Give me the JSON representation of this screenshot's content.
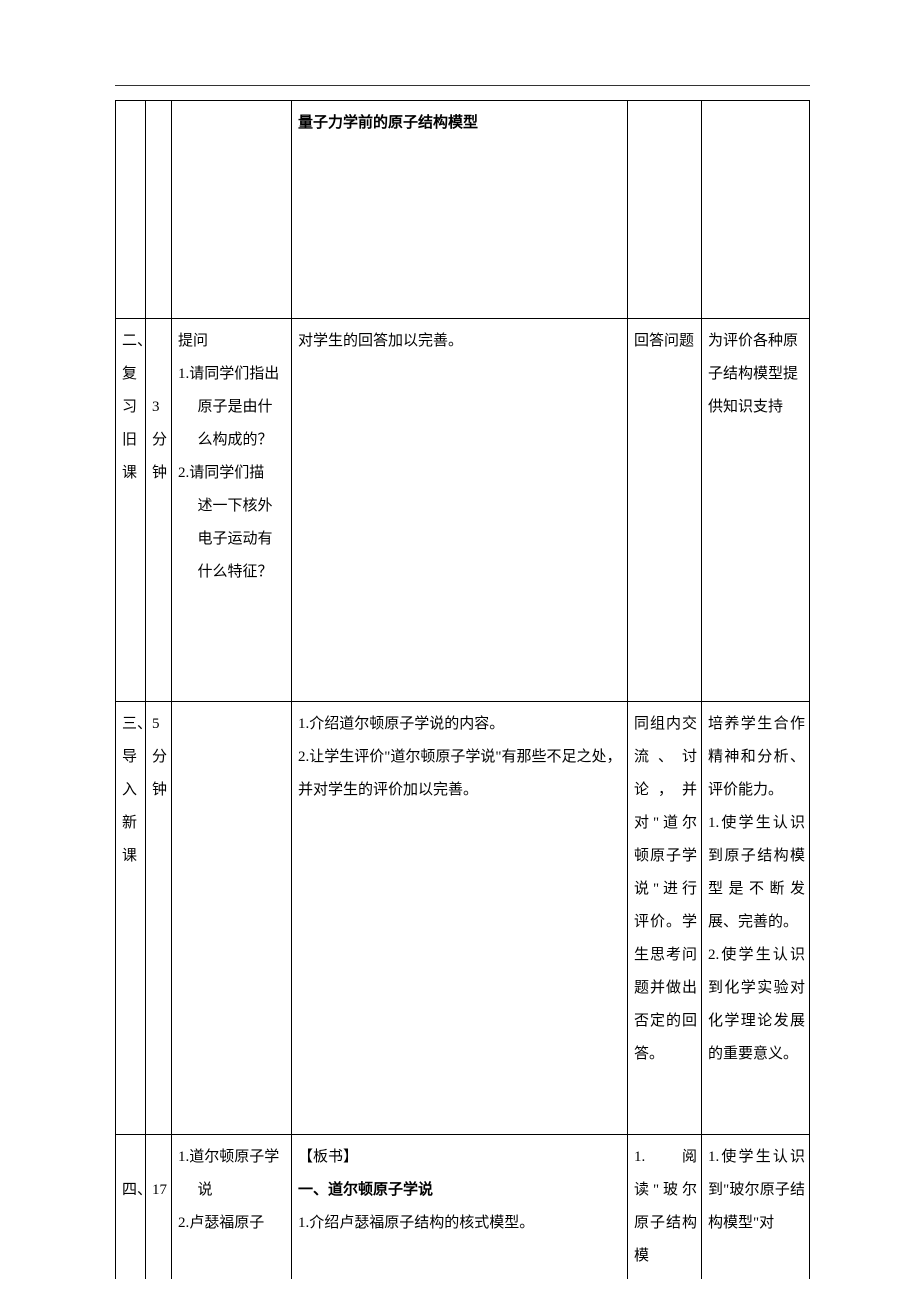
{
  "row1": {
    "col4_heading": "量子力学前的原子结构模型"
  },
  "row2": {
    "section_label": "二、复习旧课",
    "time": "3分钟",
    "q_label": "提问",
    "q1": "1.请同学们指出原子是由什么构成的？",
    "q2_head": "2.请同学们描",
    "q2_line2": "述一下核外",
    "q2_line3": "电子运动有",
    "q2_line4": "什么特征？",
    "col4": "对学生的回答加以完善。",
    "col5": "回答问题",
    "col6": "为评价各种原子结构模型提供知识支持"
  },
  "row3": {
    "section_label": "三、导入新课",
    "time": "5分钟",
    "col4_p1": "1.介绍道尔顿原子学说的内容。",
    "col4_p2": "2.让学生评价\"道尔顿原子学说\"有那些不足之处，并对学生的评价加以完善。",
    "col5": "同组内交流、讨论，并对\"道尔顿原子学说\"进行评价。学生思考问题并做出否定的回答。",
    "col6_p1": "培养学生合作精神和分析、评价能力。",
    "col6_p2": "1.使学生认识到原子结构模型是不断发展、完善的。",
    "col6_p3": "2.使学生认识到化学实验对化学理论发展的重要意义。"
  },
  "row4": {
    "section_label": "四、",
    "time": "17",
    "col3_p1": "1.道尔顿原子学说",
    "col3_p2": "2.卢瑟福原子",
    "col4_banshu": "【板书】",
    "col4_heading": "一、道尔顿原子学说",
    "col4_p1": "1.介绍卢瑟福原子结构的核式模型。",
    "col5": "1.  阅 读\"玻尔原子结构模",
    "col6": "1.使学生认识到\"玻尔原子结构模型\"对"
  }
}
